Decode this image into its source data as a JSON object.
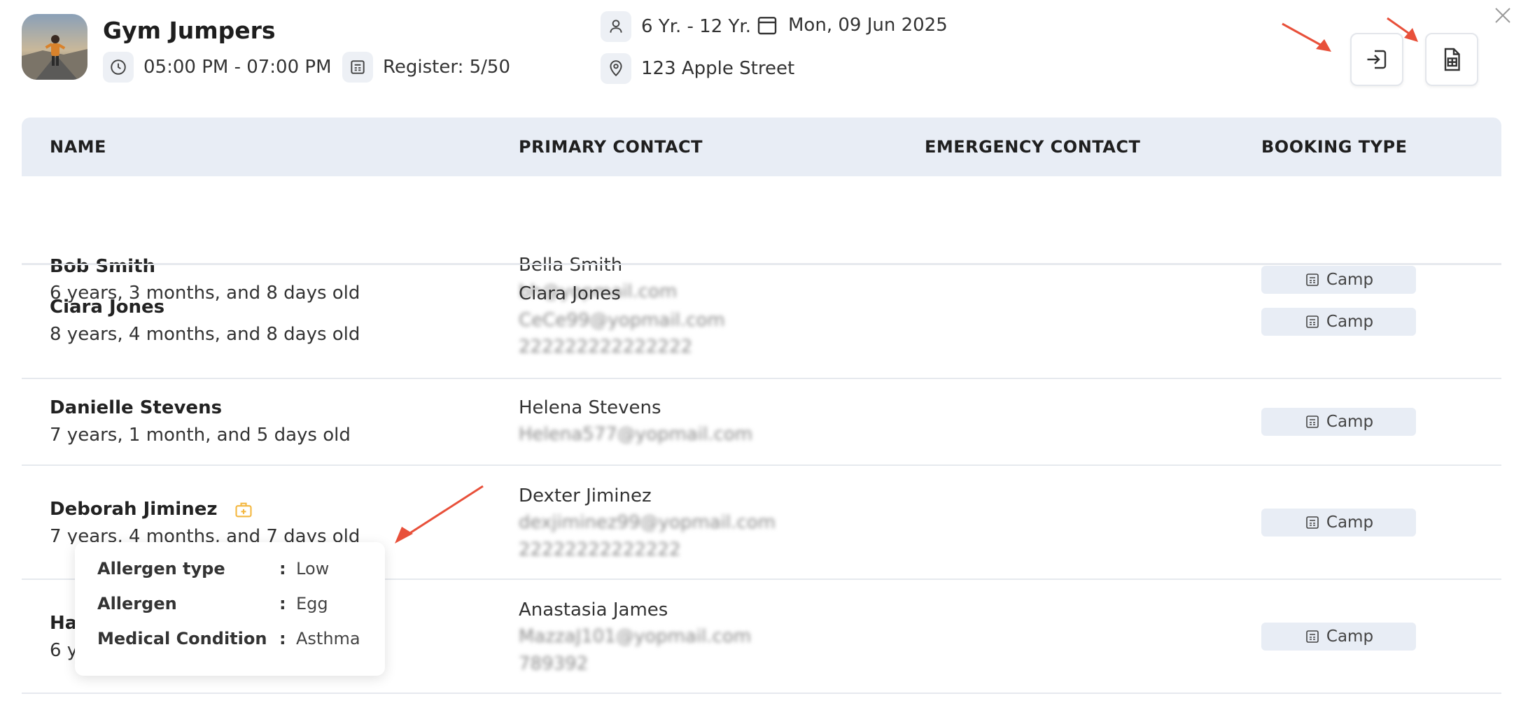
{
  "event": {
    "title": "Gym Jumpers",
    "time": "05:00 PM - 07:00 PM",
    "register": "Register: 5/50",
    "age_range": "6 Yr. - 12 Yr.",
    "date": "Mon, 09 Jun 2025",
    "location": "123 Apple Street"
  },
  "table": {
    "headers": [
      "NAME",
      "PRIMARY CONTACT",
      "EMERGENCY CONTACT",
      "BOOKING TYPE"
    ],
    "rows": [
      {
        "name": "Bob Smith",
        "age": "6 years, 3 months, and 8 days old",
        "contact_name": "Bella Smith",
        "contact_email": "bh@yopmail.com",
        "contact_phone": "",
        "booking": "Camp"
      },
      {
        "name": "Ciara Jones",
        "age": "8 years, 4 months, and 8 days old",
        "contact_name": "Ciara Jones",
        "contact_email": "CeCe99@yopmail.com",
        "contact_phone": "222222222222222",
        "booking": "Camp"
      },
      {
        "name": "Danielle Stevens",
        "age": "7 years, 1 month, and 5 days old",
        "contact_name": "Helena Stevens",
        "contact_email": "Helena577@yopmail.com",
        "contact_phone": "",
        "booking": "Camp"
      },
      {
        "name": "Deborah Jiminez",
        "age": "7 years, 4 months, and 7 days old",
        "contact_name": "Dexter Jiminez",
        "contact_email": "dexjiminez99@yopmail.com",
        "contact_phone": "22222222222222",
        "booking": "Camp"
      },
      {
        "name": "Ha",
        "age": "6 y",
        "contact_name": "Anastasia James",
        "contact_email": "MazzaJ101@yopmail.com",
        "contact_phone": "789392",
        "booking": "Camp"
      }
    ]
  },
  "tooltip": {
    "rows": [
      {
        "label": "Allergen type",
        "value": "Low"
      },
      {
        "label": "Allergen",
        "value": "Egg"
      },
      {
        "label": "Medical Condition",
        "value": "Asthma"
      }
    ]
  },
  "colors": {
    "header_bg": "#e8edf5",
    "badge_bg": "#e8edf5",
    "arrow": "#e8503a",
    "medical_icon": "#f4b740"
  }
}
